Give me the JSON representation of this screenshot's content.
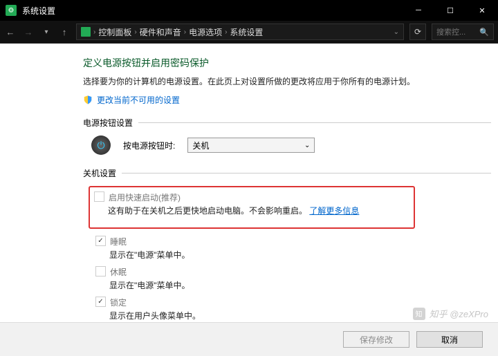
{
  "titlebar": {
    "title": "系统设置"
  },
  "breadcrumb": {
    "items": [
      "控制面板",
      "硬件和声音",
      "电源选项",
      "系统设置"
    ],
    "search_placeholder": "搜索控..."
  },
  "page": {
    "title": "定义电源按钮并启用密码保护",
    "subtitle": "选择要为你的计算机的电源设置。在此页上对设置所做的更改将应用于你所有的电源计划。",
    "change_link": "更改当前不可用的设置"
  },
  "power_button_group": {
    "header": "电源按钮设置",
    "label": "按电源按钮时:",
    "dropdown_value": "关机"
  },
  "shutdown_group": {
    "header": "关机设置",
    "fast_startup": {
      "label": "启用快速启动(推荐)",
      "desc": "这有助于在关机之后更快地启动电脑。不会影响重启。",
      "link": "了解更多信息"
    },
    "sleep": {
      "label": "睡眠",
      "desc": "显示在\"电源\"菜单中。"
    },
    "hibernate": {
      "label": "休眠",
      "desc": "显示在\"电源\"菜单中。"
    },
    "lock": {
      "label": "锁定",
      "desc": "显示在用户头像菜单中。"
    }
  },
  "footer": {
    "save": "保存修改",
    "cancel": "取消"
  },
  "watermark": {
    "text": "知乎 @zeXPro"
  }
}
